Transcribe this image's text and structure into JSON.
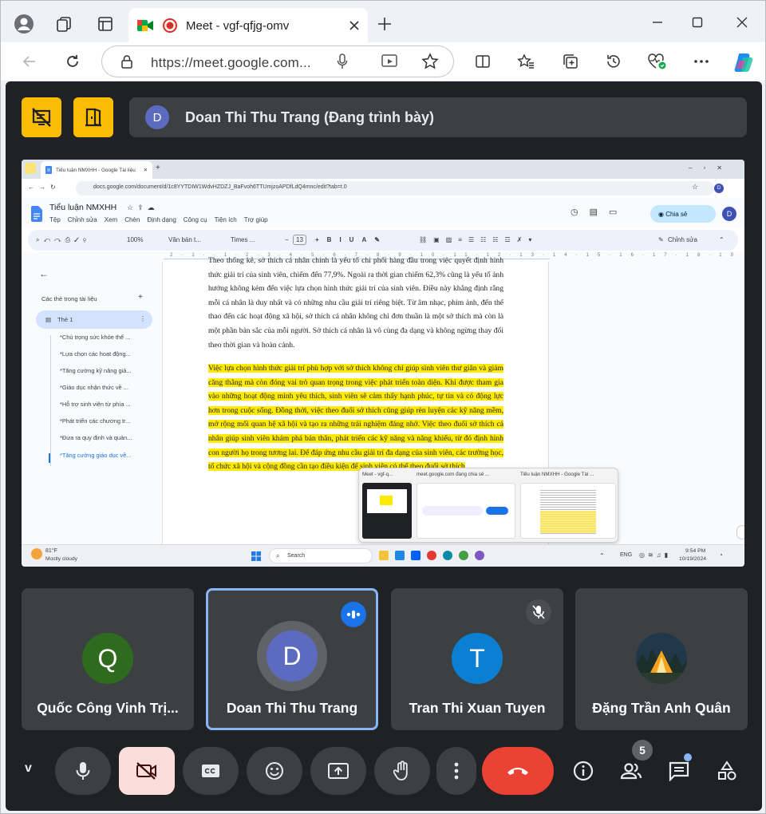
{
  "browser": {
    "tab_title": "Meet - vgf-qfjg-omv",
    "url": "https://meet.google.com..."
  },
  "meet": {
    "presenter_initial": "D",
    "presenter_text": "Doan Thi Thu Trang (Đang trình bày)",
    "participants": [
      {
        "name": "Quốc Công Vinh Trị...",
        "initial": "Q",
        "color": "#2e6b1e"
      },
      {
        "name": "Doan Thi Thu Trang",
        "initial": "D",
        "color": "#5c6bc0",
        "speaking": true
      },
      {
        "name": "Tran Thi Xuan Tuyen",
        "initial": "T",
        "color": "#0b7fd1",
        "muted": true
      },
      {
        "name": "Đặng Trần Anh Quân",
        "initial": "",
        "color": "#1b3a4a"
      }
    ],
    "people_count": "5",
    "controls": {
      "more_chevron": "v"
    }
  },
  "shared": {
    "tab_title": "Tiểu luận NMXHH - Google Tài liệu",
    "url": "docs.google.com/document/d/1c8YYTDIW1WdvHZDZJ_BaFvoh6TTUmjzoAPDfLdQ4mnc/edit?tab=t.0",
    "doc_title": "Tiểu luận NMXHH",
    "menus": [
      "Tệp",
      "Chỉnh sửa",
      "Xem",
      "Chèn",
      "Định dạng",
      "Công cụ",
      "Tiện ích",
      "Trợ giúp"
    ],
    "share_label": "Chia sẻ",
    "user_initial": "D",
    "toolbar": {
      "zoom": "100%",
      "style": "Văn bản t...",
      "font": "Times ...",
      "size": "13",
      "mode": "Chỉnh sửa"
    },
    "outline_title": "Các thẻ trong tài liệu",
    "outline_tab": "Thẻ 1",
    "outline_items": [
      "*Chú trọng sức khỏe thể ...",
      "*Lựa chọn các hoạt động...",
      "*Tăng cường kỹ năng giả...",
      "*Giáo dục nhận thức về ...",
      "*Hỗ trợ sinh viên từ phía ...",
      "*Phát triển các chương tr...",
      "*Đưa ra quy định và quản...",
      "*Tăng cường giáo dục về..."
    ],
    "para1": "Theo thống kê, sở thích cá nhân chính là yếu tố chi phối hàng đầu trong việc quyết định hình thức giải trí của sinh viên, chiếm đến 77,9%. Ngoài ra thời gian chiếm 62,3% cũng là yếu tố ảnh hưởng không kém đến việc lựa chọn hình thức giải trí của sinh viên. Điều này khẳng định rằng mỗi cá nhân là duy nhất và có những nhu cầu giải trí riêng biệt. Từ âm nhạc, phim ảnh, đến thể thao đến các hoạt động xã hội, sở thích cá nhân không chỉ đơn thuần là một sở thích mà còn là một phần bản sắc của mỗi người. Sở thích cá nhân là vô cùng đa dạng và không ngừng thay đổi theo thời gian và hoàn cảnh.",
    "para2": "Việc lựa chọn hình thức giải trí phù hợp với sở thích không chỉ giúp sinh viên thư giãn và giảm căng thẳng mà còn đóng vai trò quan trọng trong việc phát triển toàn diện. Khi được tham gia vào những hoạt động mình yêu thích, sinh viên sẽ cảm thấy hạnh phúc, tự tin và có động lực hơn trong cuộc sống. Đồng thời, việc theo đuổi sở thích cũng giúp rèn luyện các kỹ năng mềm, mở rộng mối quan hệ xã hội và tạo ra những trải nghiệm đáng nhớ. Việc theo đuổi sở thích cá nhân giúp sinh viên khám phá bản thân, phát triển các kỹ năng và năng khiếu, từ đó định hình con người họ trong tương lai. Để đáp ứng nhu cầu giải trí đa dạng của sinh viên, các trường học, tổ chức xã hội và cộng đồng cần tạo điều kiện để sinh viên có thể theo đuổi sở thích",
    "popup_labels": [
      "Meet - vgf-q...",
      "meet.google.com đang chia sẻ ...",
      "Tiểu luận NMXHH - Google Tài ..."
    ],
    "weather_temp": "81°F",
    "weather_desc": "Mostly cloudy",
    "search_label": "Search",
    "lang": "ENG",
    "time": "9:54 PM",
    "date": "10/19/2024"
  }
}
